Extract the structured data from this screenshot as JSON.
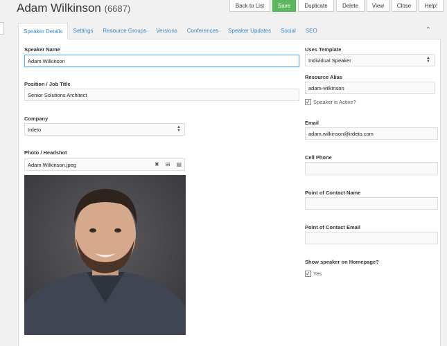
{
  "header": {
    "name": "Adam Wilkinson",
    "id": "(6687)"
  },
  "actions": [
    {
      "label": "Back to List",
      "name": "back-to-list-button"
    },
    {
      "label": "Save",
      "name": "save-button"
    },
    {
      "label": "Duplicate",
      "name": "duplicate-button"
    },
    {
      "label": "Delete",
      "name": "delete-button"
    },
    {
      "label": "View",
      "name": "view-button"
    },
    {
      "label": "Close",
      "name": "close-button"
    },
    {
      "label": "Help!",
      "name": "help-button"
    }
  ],
  "tabs": [
    "Speaker Details",
    "Settings",
    "Resource Groups",
    "Versions",
    "Conferences",
    "Speaker Updates",
    "Social",
    "SEO"
  ],
  "left": {
    "speaker_name": {
      "label": "Speaker Name",
      "value": "Adam Wilkinson"
    },
    "job_title": {
      "label": "Position / Job Title",
      "value": "Senior Solutions Architect"
    },
    "company": {
      "label": "Company",
      "value": "Irdeto"
    },
    "photo": {
      "label": "Photo / Headshot",
      "value": "Adam Wilkinson.jpeg"
    }
  },
  "right": {
    "template": {
      "label": "Uses Template",
      "value": "Individual Speaker"
    },
    "alias": {
      "label": "Resource Alias",
      "value": "adam-wilkinson"
    },
    "active": {
      "label": "Speaker is Active?",
      "checked": true
    },
    "email": {
      "label": "Email",
      "value": "adam.wilkinson@irdeto.com"
    },
    "cell": {
      "label": "Cell Phone",
      "value": ""
    },
    "contact_name": {
      "label": "Point of Contact Name",
      "value": ""
    },
    "contact_email": {
      "label": "Point of Contact Email",
      "value": ""
    },
    "homepage": {
      "label": "Show speaker on Homepage?",
      "option": "Yes",
      "checked": true
    }
  },
  "colors": {
    "save": "#5cb85c",
    "tab_link": "#3a87c8",
    "focus": "#66afe9"
  }
}
